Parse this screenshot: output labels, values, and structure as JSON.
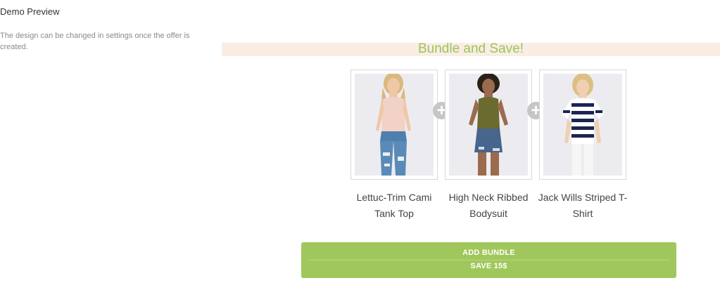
{
  "demo": {
    "title": "Demo Preview",
    "description": "The design can be changed in settings once the offer is created."
  },
  "bundle": {
    "heading": "Bundle and Save!",
    "products": [
      {
        "name": "Lettuc-Trim Cami Tank Top",
        "image": "woman-in-pink-cami-and-ripped-jeans"
      },
      {
        "name": "High Neck Ribbed Bodysuit",
        "image": "woman-in-olive-bodysuit-and-denim-shorts"
      },
      {
        "name": "Jack Wills Striped T-Shirt",
        "image": "woman-in-navy-striped-tshirt"
      }
    ],
    "button": {
      "line1": "ADD BUNDLE",
      "line2": "SAVE 15$"
    }
  },
  "colors": {
    "accent": "#a0c75c",
    "banner_bg": "#f9ede4",
    "heading": "#9dc35a"
  }
}
